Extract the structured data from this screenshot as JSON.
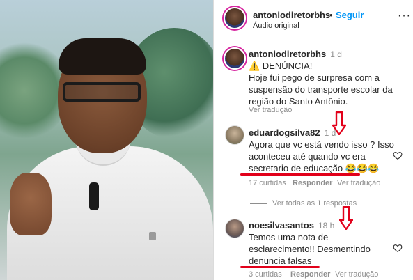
{
  "header": {
    "username": "antoniodiretorbhs",
    "separator": "•",
    "follow_label": "Seguir",
    "subtitle": "Áudio original",
    "more_label": "···"
  },
  "caption": {
    "username": "antoniodiretorbhs",
    "time": "1 d",
    "line1": "⚠️ DENÚNCIA!",
    "line2": "Hoje fui pego de surpresa com a",
    "line3": "suspensão do transporte escolar da",
    "line4": "região do Santo Antônio.",
    "translate": "Ver tradução"
  },
  "comments": [
    {
      "username": "eduardogsilva82",
      "time": "1 d",
      "line1": "Agora que vc está vendo isso ? Isso",
      "line2": "aconteceu até quando vc era",
      "line3": "secretario de educação 😂😂😂",
      "likes": "17 curtidas",
      "reply": "Responder",
      "translate": "Ver tradução",
      "view_replies": "Ver todas as 1 respostas"
    },
    {
      "username": "noesilvasantos",
      "time": "18 h",
      "line1": "Temos uma nota de",
      "line2": "esclarecimento!! Desmentindo",
      "line3": "denuncia falsas",
      "likes": "3 curtidas",
      "reply": "Responder",
      "translate": "Ver tradução"
    }
  ],
  "colors": {
    "accent": "#0095f6",
    "annotation": "#e2001a"
  },
  "icons": [
    "heart-icon",
    "more-icon",
    "down-arrow-annotation-icon",
    "warning-icon"
  ]
}
